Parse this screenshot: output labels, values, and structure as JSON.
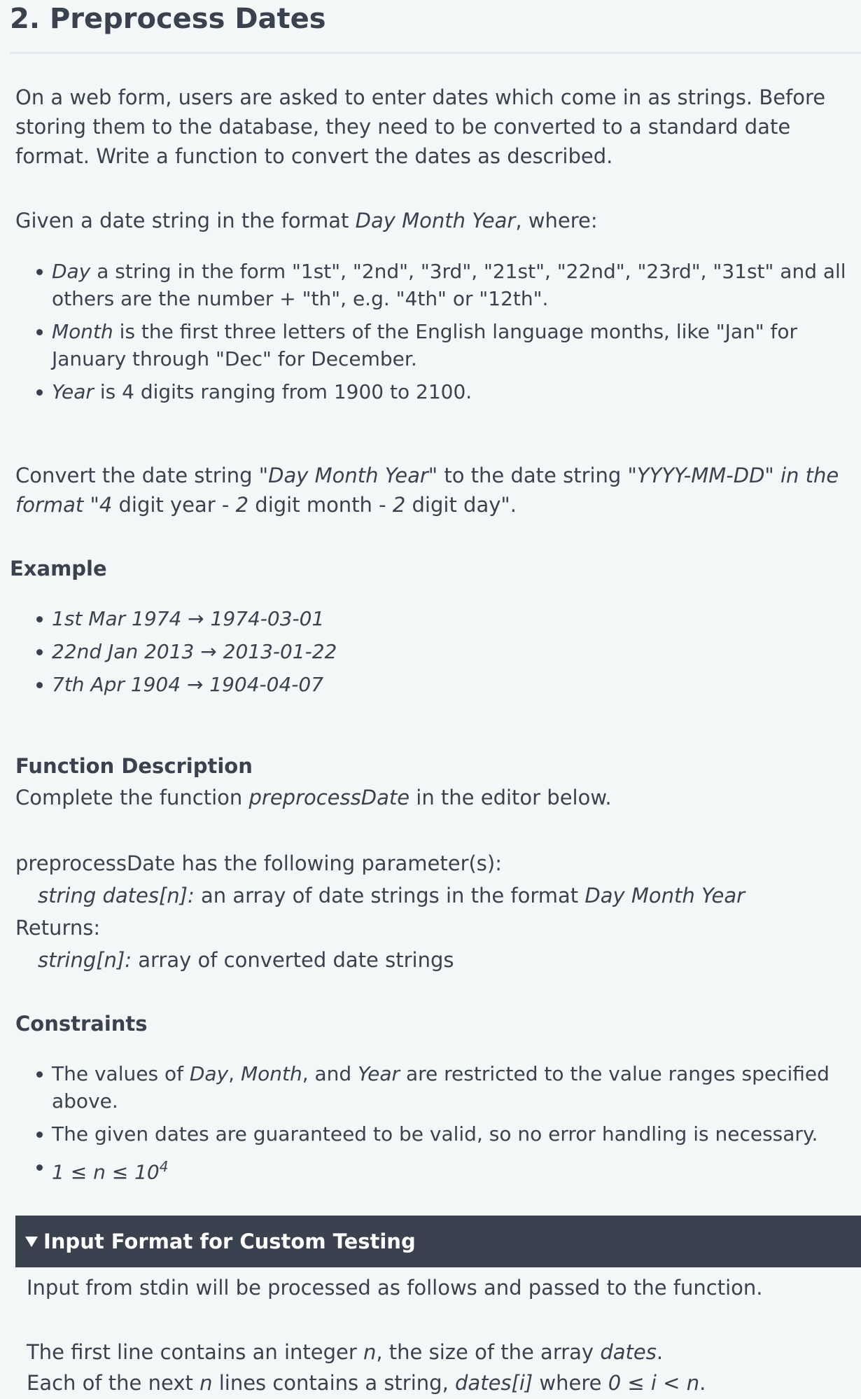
{
  "title": "2. Preprocess Dates",
  "intro": "On a web form, users are asked to enter dates which come in as strings. Before storing them to the database, they need to be converted to a standard date format. Write a function to convert the dates as described.",
  "given": {
    "pre": "Given a date string in the format ",
    "em": "Day Month Year",
    "post": ", where:"
  },
  "rules": [
    {
      "em": "Day",
      "text": " a string in the form \"1st\", \"2nd\", \"3rd\", \"21st\", \"22nd\", \"23rd\", \"31st\" and all others are the number + \"th\", e.g. \"4th\" or \"12th\"."
    },
    {
      "em": "Month",
      "text": " is the first three letters of the English language months, like \"Jan\" for January through \"Dec\" for December."
    },
    {
      "em": "Year",
      "text": " is 4 digits ranging from 1900 to 2100."
    }
  ],
  "convert": {
    "p1": "Convert the date string \"",
    "em1": "Day Month Year\"",
    "p2": " to the date string \"",
    "em2": "YYYY-MM-DD\" in the format \"4",
    "p3": " digit year - ",
    "em3": "2",
    "p4": " digit month - ",
    "em4": "2",
    "p5": " digit day\"."
  },
  "example_heading": "Example",
  "examples": [
    "1st Mar 1974 → 1974-03-01",
    "22nd Jan 2013 → 2013-01-22",
    "7th Apr 1904 → 1904-04-07"
  ],
  "function_heading": "Function Description",
  "function_line": {
    "pre": "Complete the function ",
    "em": "preprocessDate",
    "post": " in the editor below."
  },
  "params_line": "preprocessDate has the following parameter(s):",
  "param1": {
    "em": "string dates[n]:",
    "text": "  an array of date strings in the format ",
    "em2": "Day Month Year"
  },
  "returns_label": "Returns:",
  "return1": {
    "em": "string[n]:",
    "text": " array of converted date strings"
  },
  "constraints_heading": "Constraints",
  "constraints": [
    {
      "p1": "The values of ",
      "e1": "Day",
      "p2": ", ",
      "e2": "Month",
      "p3": ", and ",
      "e3": "Year",
      "p4": " are restricted to the value ranges specified above."
    },
    {
      "p1": "The given dates are guaranteed to be valid, so no error handling is necessary."
    },
    {
      "math": "1 ≤ n ≤ 10",
      "sup": "4"
    }
  ],
  "input_format_heading": "Input Format for Custom Testing",
  "input_intro": "Input from stdin will be processed as follows and passed to the function.",
  "input_line1": {
    "pre": "The first line contains an integer ",
    "em": "n",
    "mid": ", the size of the array ",
    "em2": "dates",
    "post": "."
  },
  "input_line2": {
    "pre": "Each of the next ",
    "em": "n",
    "mid": " lines contains a string, ",
    "em2": "dates[i]",
    "mid2": " where ",
    "em3": "0 ≤ i < n",
    "post": "."
  }
}
